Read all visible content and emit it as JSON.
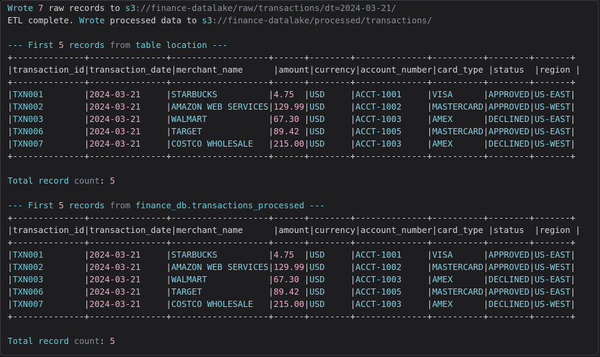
{
  "log": {
    "line1": {
      "w1": "Wrote",
      "n": "7",
      "w2": " raw records to ",
      "scheme": "s3",
      "path": "://finance-datalake/raw/transactions/dt=2024-03-21/"
    },
    "line2": {
      "w0": "ETL complete. ",
      "w1": "Wrote",
      "w2": " processed data to ",
      "scheme": "s3",
      "path": "://finance-datalake/processed/transactions/"
    }
  },
  "sections": [
    {
      "header_pre": "--- First ",
      "n": "5",
      "header_post_a": " records ",
      "from_kw": "from",
      "header_post_b": " table location ---",
      "total_label": "Total record ",
      "count_kw": "count",
      "count_sep": ": ",
      "total_value": "5"
    },
    {
      "header_pre": "--- First ",
      "n": "5",
      "header_post_a": " records ",
      "from_kw": "from",
      "header_post_b": " finance_db.transactions_processed ---",
      "total_label": "Total record ",
      "count_kw": "count",
      "count_sep": ": ",
      "total_value": "5"
    }
  ],
  "table": {
    "border": "+--------------+---------------+-------------------+------+--------+--------------+----------+--------+-------+",
    "headers": [
      "transaction_id",
      "transaction_date",
      "merchant_name",
      "amount",
      "currency",
      "account_number",
      "card_type",
      "status",
      "region"
    ],
    "header_line": "|transaction_id|transaction_date|merchant_name      |amount|currency|account_number|card_type |status  |region |",
    "rows": [
      [
        "TXN001",
        "2024-03-21",
        "STARBUCKS",
        "4.75",
        "USD",
        "ACCT-1001",
        "VISA",
        "APPROVED",
        "US-EAST"
      ],
      [
        "TXN002",
        "2024-03-21",
        "AMAZON WEB SERVICES",
        "129.99",
        "USD",
        "ACCT-1002",
        "MASTERCARD",
        "APPROVED",
        "US-WEST"
      ],
      [
        "TXN003",
        "2024-03-21",
        "WALMART",
        "67.30",
        "USD",
        "ACCT-1003",
        "AMEX",
        "DECLINED",
        "US-EAST"
      ],
      [
        "TXN006",
        "2024-03-21",
        "TARGET",
        "89.42",
        "USD",
        "ACCT-1005",
        "MASTERCARD",
        "APPROVED",
        "US-EAST"
      ],
      [
        "TXN007",
        "2024-03-21",
        "COSTCO WHOLESALE",
        "215.00",
        "USD",
        "ACCT-1003",
        "AMEX",
        "DECLINED",
        "US-WEST"
      ]
    ]
  },
  "colors": {
    "background": "#1e1e21",
    "accent_cyan": "#5fd1e0",
    "accent_pink": "#f2a9c9",
    "text": "#d4d4d4"
  }
}
